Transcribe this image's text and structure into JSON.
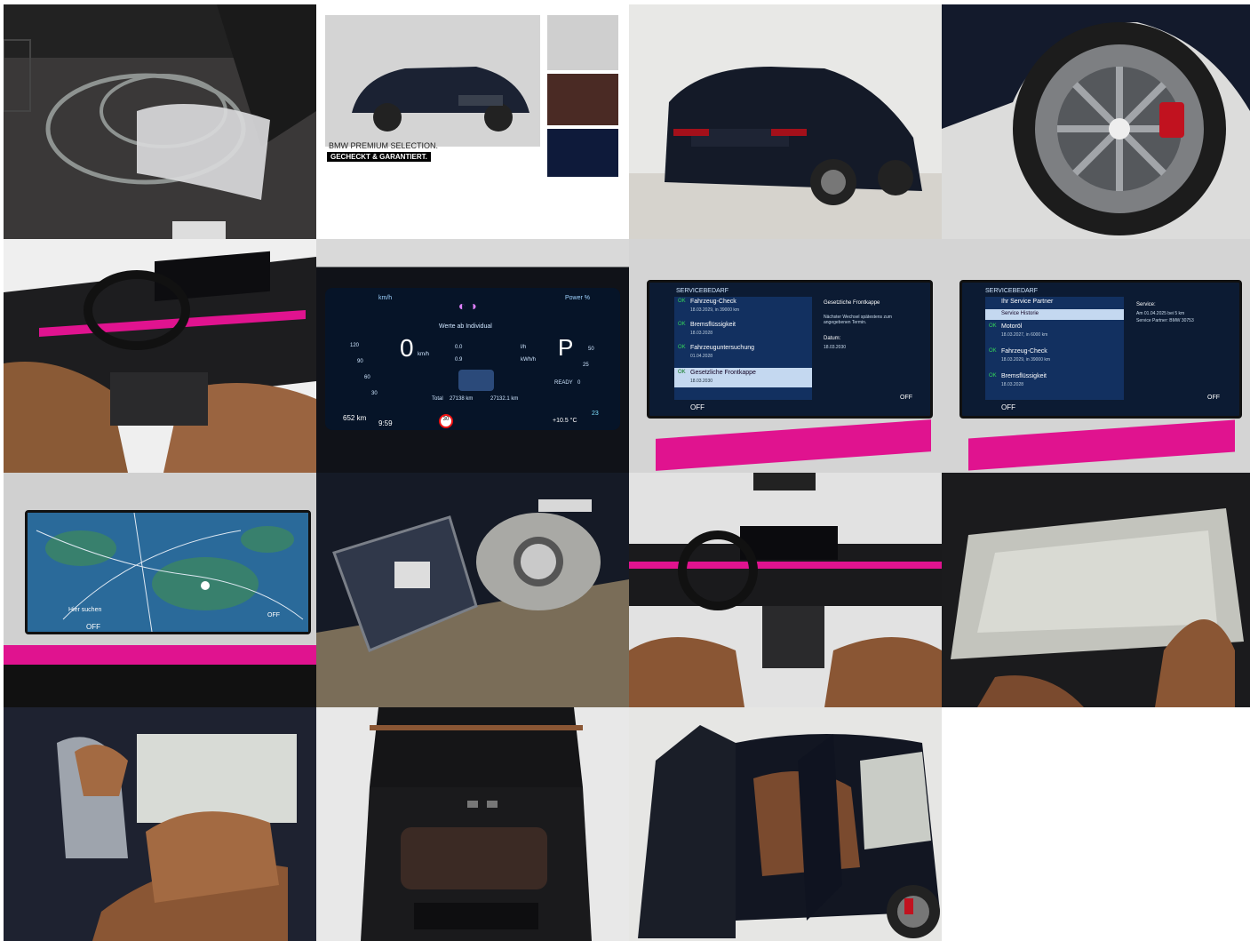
{
  "gallery": {
    "tiles": [
      {
        "subject": "trunk-charging-cable"
      },
      {
        "subject": "premium-selection-brochure"
      },
      {
        "subject": "rear-exterior"
      },
      {
        "subject": "wheel-closeup"
      },
      {
        "subject": "front-interior-dashboard"
      },
      {
        "subject": "instrument-cluster"
      },
      {
        "subject": "service-screen-1"
      },
      {
        "subject": "service-screen-2"
      },
      {
        "subject": "navigation-map"
      },
      {
        "subject": "charging-port"
      },
      {
        "subject": "cockpit-overview"
      },
      {
        "subject": "panorama-roof"
      },
      {
        "subject": "rear-seats"
      },
      {
        "subject": "rear-console"
      },
      {
        "subject": "side-doors-open"
      }
    ]
  },
  "brochure": {
    "brand_line": "BMW PREMIUM SELECTION.",
    "tagline": "GECHECKT & GARANTIERT."
  },
  "cluster": {
    "speed": "0",
    "speed_unit": "km/h",
    "gear": "P",
    "center_title": "Werte ab Individual",
    "total_label": "Total",
    "total_km": "27138 km",
    "trip_km": "27132.1 km",
    "left_header": "km/h",
    "right_header": "Power %",
    "range": "652 km",
    "clock": "9:59",
    "temp": "+10.5 °C",
    "ready": "READY",
    "row1_value": "0.0",
    "row1_unit": "l/h",
    "row2_value": "0.9",
    "row2_unit": "kWh/h",
    "battery_pct": "23",
    "speed_limit": "30",
    "left_ticks": [
      "120",
      "90",
      "60",
      "30"
    ],
    "right_ticks": [
      "50",
      "25",
      "0"
    ]
  },
  "service1": {
    "header": "SERVICEBEDARF",
    "items": [
      {
        "status": "OK",
        "title": "Fahrzeug-Check",
        "detail": "18.03.2029, in 39000 km"
      },
      {
        "status": "OK",
        "title": "Bremsflüssigkeit",
        "detail": "18.03.2028"
      },
      {
        "status": "OK",
        "title": "Fahrzeuguntersuchung",
        "detail": "01.04.2028"
      },
      {
        "status": "OK",
        "title": "Gesetzliche Frontkappe",
        "detail": "18.03.2030"
      }
    ],
    "detail_title": "Gesetzliche Frontkappe",
    "detail_text": "Nächster Wechsel spätestens zum angegebenen Termin.",
    "date_label": "Datum:",
    "date_value": "18.03.2030",
    "climate_off": "OFF",
    "off_right": "OFF"
  },
  "service2": {
    "header": "SERVICEBEDARF",
    "partner_item": "Ihr Service Partner",
    "history_item": "Service Historie",
    "items": [
      {
        "status": "OK",
        "title": "Motoröl",
        "detail": "18.03.2027, in 6000 km"
      },
      {
        "status": "OK",
        "title": "Fahrzeug-Check",
        "detail": "18.03.2029, in 39000 km"
      },
      {
        "status": "OK",
        "title": "Bremsflüssigkeit",
        "detail": "18.03.2028"
      }
    ],
    "side_title": "Service:",
    "side_line1": "Am 01.04.2025 bei 5 km",
    "side_line2": "Service Partner: BMW 30753",
    "climate_off": "OFF",
    "off_right": "OFF"
  },
  "navmap": {
    "search": "Hier suchen",
    "climate_off": "OFF",
    "off_right": "OFF"
  }
}
